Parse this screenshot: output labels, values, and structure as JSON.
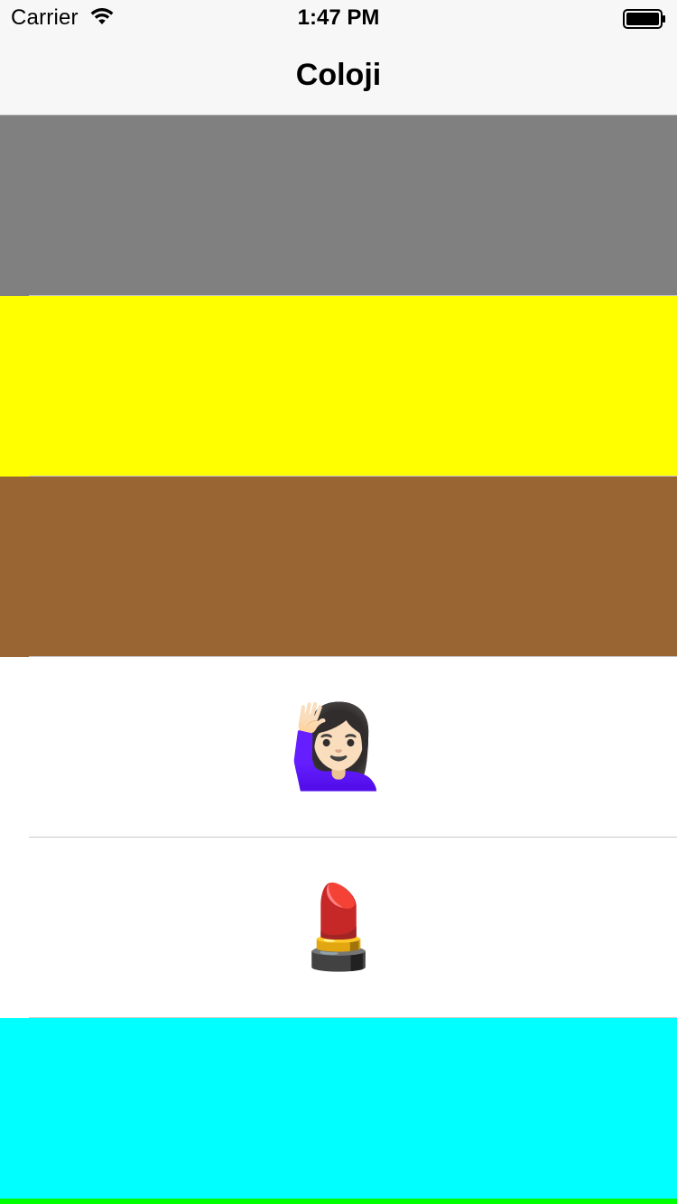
{
  "status_bar": {
    "carrier": "Carrier",
    "time": "1:47 PM",
    "wifi_icon": "wifi-icon",
    "battery_icon": "battery-icon"
  },
  "nav_bar": {
    "title": "Coloji"
  },
  "rows": [
    {
      "kind": "color",
      "color": "#808080"
    },
    {
      "kind": "color",
      "color": "#ffff00"
    },
    {
      "kind": "color",
      "color": "#996633"
    },
    {
      "kind": "emoji",
      "emoji": "🙋🏻‍♀️"
    },
    {
      "kind": "emoji",
      "emoji": "💄"
    },
    {
      "kind": "color",
      "color": "#00ffff"
    },
    {
      "kind": "color",
      "color": "#00ff00"
    }
  ]
}
